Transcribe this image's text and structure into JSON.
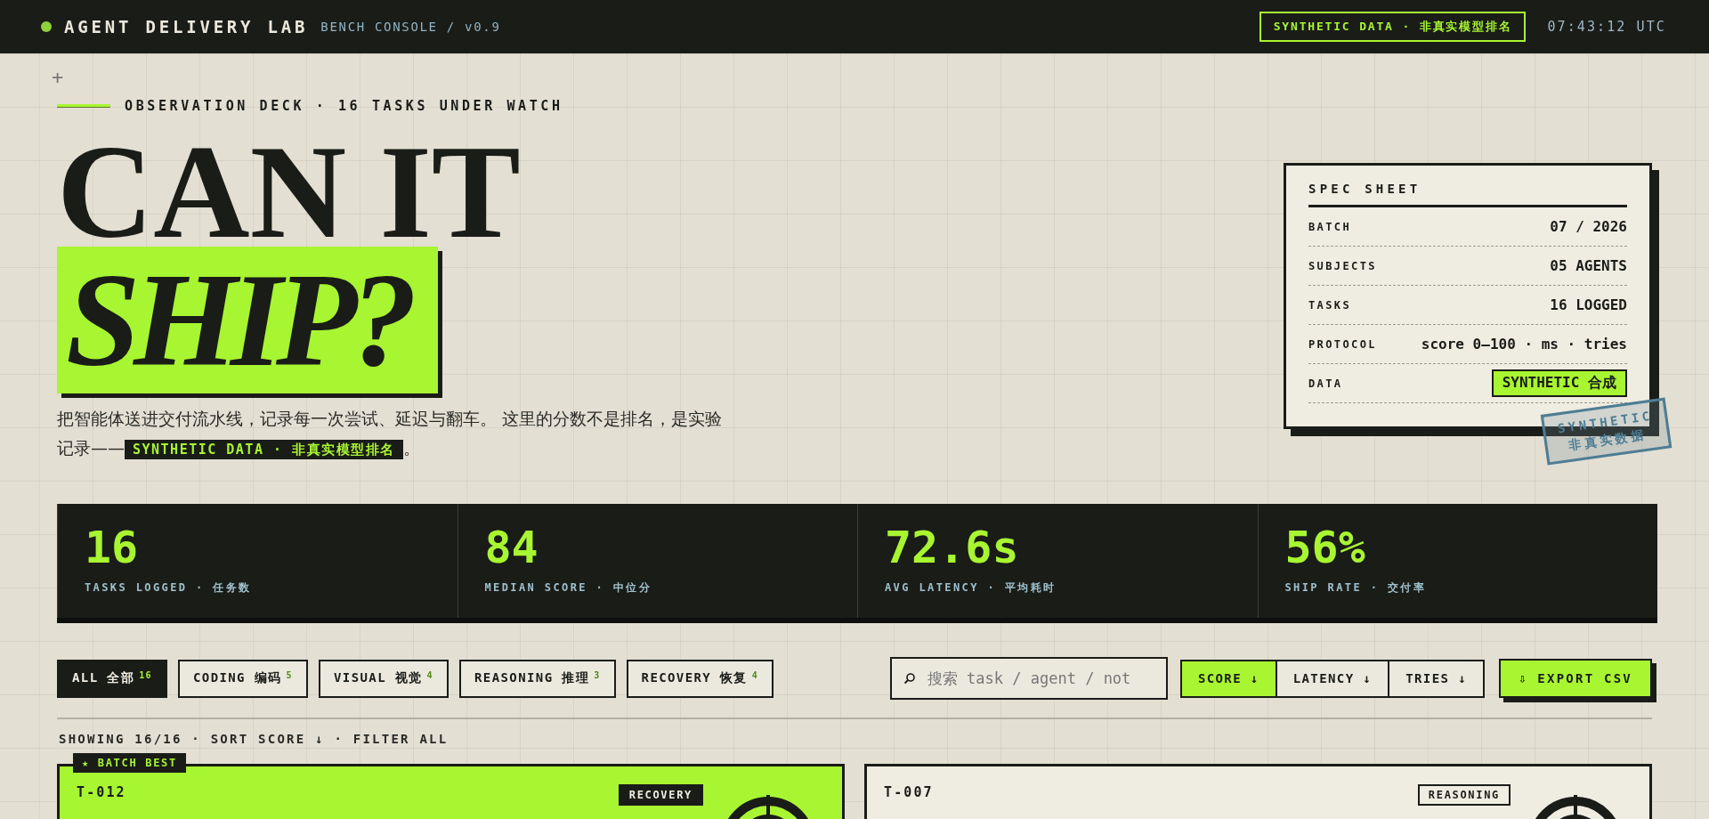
{
  "top_bar": {
    "brand": "AGENT DELIVERY LAB",
    "subtitle": "BENCH CONSOLE / v0.9",
    "badge": "SYNTHETIC DATA · 非真实模型排名",
    "clock": "07:43:12 UTC"
  },
  "hero": {
    "corner_mark": "+",
    "eyebrow": "OBSERVATION DECK · 16 TASKS UNDER WATCH",
    "title_line_1": "CAN IT",
    "title_line_2": "SHIP?",
    "intro": "把智能体送进交付流水线，记录每一次尝试、延迟与翻车。 这里的分数不是排名，是实验记录——",
    "intro_tag": "SYNTHETIC DATA · 非真实模型排名",
    "intro_end": "。"
  },
  "spec_sheet": {
    "title": "SPEC SHEET",
    "rows": [
      {
        "label": "BATCH",
        "value": "07 / 2026",
        "kind": "text"
      },
      {
        "label": "SUBJECTS",
        "value": "05 AGENTS",
        "kind": "text"
      },
      {
        "label": "TASKS",
        "value": "16 LOGGED",
        "kind": "text"
      },
      {
        "label": "PROTOCOL",
        "value": "score 0–100 · ms · tries",
        "kind": "text"
      },
      {
        "label": "DATA",
        "value": "SYNTHETIC 合成",
        "kind": "tag"
      }
    ],
    "stamp": {
      "line_1": "SYNTHETIC",
      "line_2": "非真实数据"
    }
  },
  "stats": [
    {
      "value": "16",
      "label": "TASKS LOGGED · 任务数"
    },
    {
      "value": "84",
      "label": "MEDIAN SCORE · 中位分"
    },
    {
      "value": "72.6s",
      "label": "AVG LATENCY · 平均耗时"
    },
    {
      "value": "56%",
      "label": "SHIP RATE · 交付率"
    }
  ],
  "filters": [
    {
      "label": "ALL 全部",
      "count": "16",
      "selected": true
    },
    {
      "label": "CODING 编码",
      "count": "5",
      "selected": false
    },
    {
      "label": "VISUAL 视觉",
      "count": "4",
      "selected": false
    },
    {
      "label": "REASONING 推理",
      "count": "3",
      "selected": false
    },
    {
      "label": "RECOVERY 恢复",
      "count": "4",
      "selected": false
    }
  ],
  "search": {
    "placeholder": "搜索 task / agent / not"
  },
  "sort_buttons": [
    {
      "label": "SCORE ↓",
      "selected": true
    },
    {
      "label": "LATENCY ↓",
      "selected": false
    },
    {
      "label": "TRIES ↓",
      "selected": false
    }
  ],
  "export_button": "⇩ EXPORT CSV",
  "status_line": "SHOWING 16/16 · SORT SCORE ↓ · FILTER ALL",
  "cards": [
    {
      "id": "T-012",
      "category": "RECOVERY",
      "best_badge": "★ BATCH BEST",
      "highlighted": true
    },
    {
      "id": "T-007",
      "category": "REASONING",
      "highlighted": false
    }
  ]
}
